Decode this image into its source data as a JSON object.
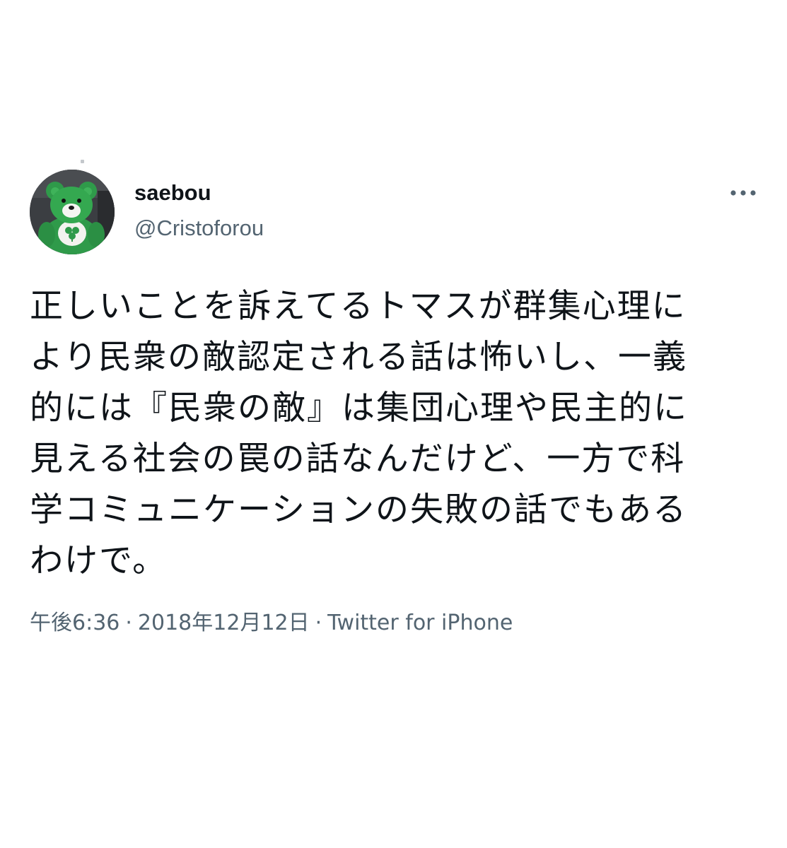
{
  "tweet": {
    "display_name": "saebou",
    "handle": "@Cristoforou",
    "text": "正しいことを訴えてるトマスが群集心理に\nより民衆の敵認定される話は怖いし、一義\n的には『民衆の敵』は集団心理や民主的に\n見える社会の罠の話なんだけど、一方で科\n学コミュニケーションの失敗の話でもある\nわけで。",
    "time": "午後6:36",
    "separator": "·",
    "date": "2018年12月12日",
    "source": "Twitter for iPhone"
  },
  "icons": {
    "avatar": "green-teddy-bear-avatar",
    "more": "more-horizontal-icon"
  },
  "colors": {
    "text_primary": "#0f1419",
    "text_secondary": "#536471",
    "background": "#ffffff",
    "avatar_bear": "#2f9a4a"
  }
}
